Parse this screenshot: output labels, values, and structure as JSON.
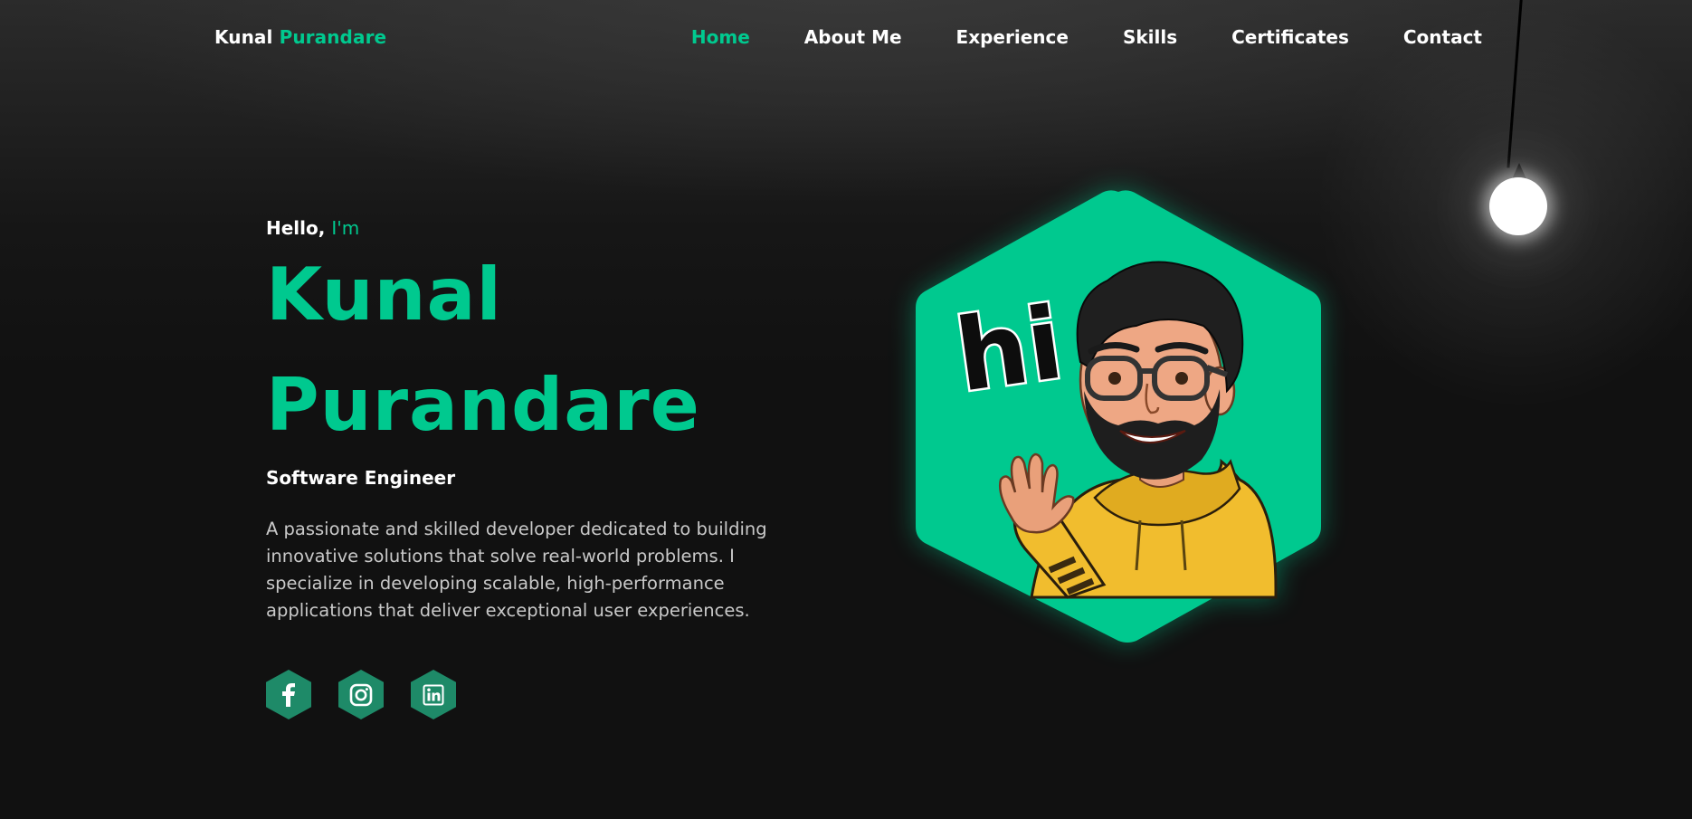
{
  "header": {
    "logo_first": "Kunal",
    "logo_last": "Purandare",
    "nav": [
      "Home",
      "About Me",
      "Experience",
      "Skills",
      "Certificates",
      "Contact"
    ]
  },
  "hero": {
    "greeting": "Hello,",
    "greeting_accent": "I'm",
    "name_line1": "Kunal",
    "name_line2": "Purandare",
    "role": "Software Engineer",
    "description": "A passionate and skilled developer dedicated to building innovative solutions that solve real-world problems. I specialize in developing scalable, high-performance applications that deliver exceptional user experiences."
  },
  "avatar": {
    "caption": "hi"
  },
  "socials": {
    "icons": [
      "facebook-icon",
      "instagram-icon",
      "linkedin-icon"
    ]
  },
  "colors": {
    "accent": "#00c98f",
    "background": "#111111",
    "social_bg": "#1e8a68"
  }
}
